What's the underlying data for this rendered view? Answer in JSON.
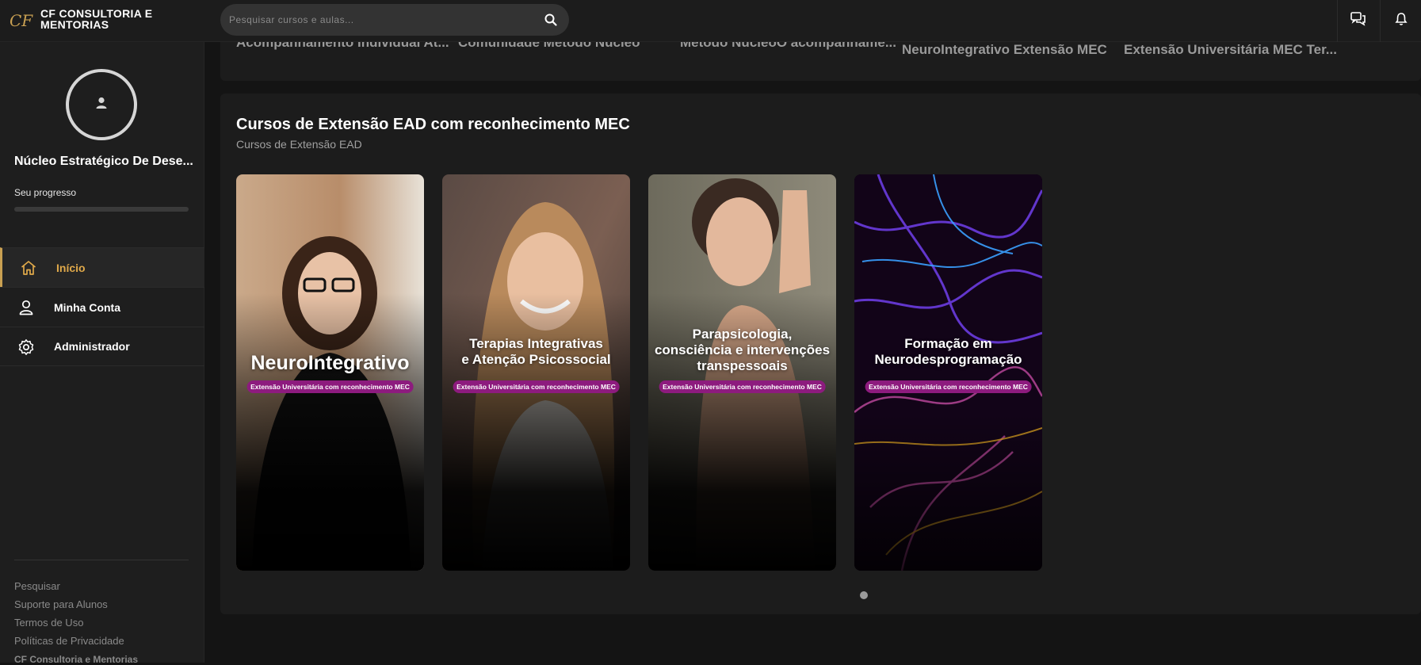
{
  "app": {
    "brand": "CF CONSULTORIA E\nMENTORIAS",
    "logo_text": "CF",
    "accent_color": "#c9a052"
  },
  "search": {
    "placeholder": "Pesquisar cursos e aulas...",
    "value": "",
    "icon": "search-icon"
  },
  "topbar_icons": [
    "chat-icon",
    "bell-icon"
  ],
  "sidebar": {
    "user_name": "Núcleo Estratégico De Dese...",
    "progress_label": "Seu progresso",
    "progress": 0,
    "items": [
      {
        "label": "Início",
        "icon": "home-icon",
        "active": true
      },
      {
        "label": "Minha Conta",
        "icon": "user-icon",
        "active": false
      },
      {
        "label": "Administrador",
        "icon": "gear-icon",
        "active": false
      }
    ],
    "links": [
      "Pesquisar",
      "Suporte para Alunos",
      "Termos de Uso",
      "Políticas de Privacidade"
    ],
    "footer": "CF Consultoria e Mentorias"
  },
  "previous_row": {
    "titles": [
      "Acompanhamento Individual At...",
      "Comunidade Método Núcleo",
      "Método NúcleoO acompanhame...",
      "NeuroIntegrativo Extensão MEC",
      "Extensão Universitária MEC Ter..."
    ]
  },
  "section": {
    "title": "Cursos de Extensão EAD com reconhecimento MEC",
    "subtitle": "Cursos de Extensão EAD",
    "cards": [
      {
        "title": "NeuroIntegrativo",
        "badge": "Extensão Universitária com reconhecimento MEC"
      },
      {
        "title": "Terapias Integrativas\ne Atenção Psicossocial",
        "badge": "Extensão Universitária com reconhecimento MEC"
      },
      {
        "title": "Parapsicologia,\nconsciência e intervenções\ntranspessoais",
        "badge": "Extensão Universitária com reconhecimento MEC"
      },
      {
        "title": "Formação em\nNeurodesprogramação",
        "badge": "Extensão Universitária com reconhecimento MEC"
      }
    ],
    "pagination_pages": 1,
    "pagination_active": 1
  }
}
